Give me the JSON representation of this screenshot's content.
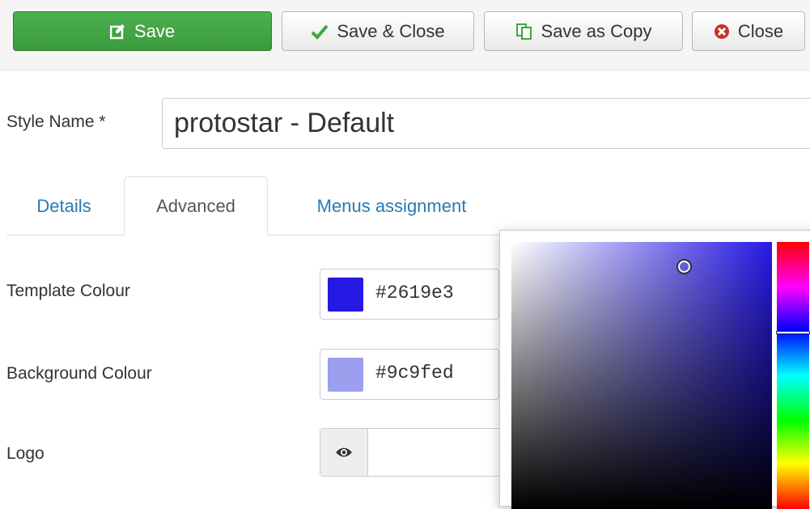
{
  "toolbar": {
    "save_label": "Save",
    "save_close_label": "Save & Close",
    "save_copy_label": "Save as Copy",
    "close_label": "Close",
    "save_color": "#3fa541"
  },
  "style_name": {
    "label": "Style Name *",
    "value": "protostar - Default"
  },
  "tabs": [
    {
      "label": "Details",
      "active": false
    },
    {
      "label": "Advanced",
      "active": true
    },
    {
      "label": "Menus assignment",
      "active": false
    }
  ],
  "fields": {
    "template_colour": {
      "label": "Template Colour",
      "value": "#2619e3"
    },
    "background_colour": {
      "label": "Background Colour",
      "value": "#9c9fed"
    },
    "logo": {
      "label": "Logo",
      "value": ""
    }
  },
  "color_picker": {
    "hue_color": "#2619e3",
    "saturation": 0.66,
    "brightness": 0.91,
    "hue_fraction": 0.34
  }
}
